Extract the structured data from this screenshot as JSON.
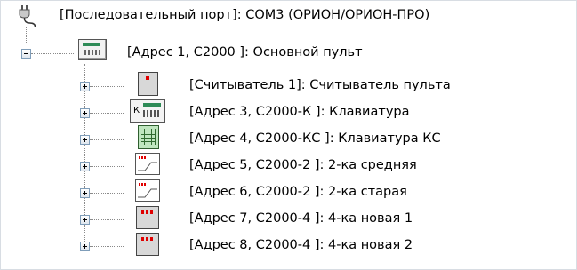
{
  "tree": {
    "root": {
      "label": "[Последовательный порт]: COM3 (ОРИОН/ОРИОН-ПРО)",
      "icon": "serial-port-plug-icon"
    },
    "panel": {
      "label": "[Адрес 1, С2000 ]: Основной пульт",
      "icon": "control-panel-icon",
      "expanded": true
    },
    "children": [
      {
        "label": "[Считыватель 1]: Считыватель пульта",
        "icon": "reader-device-icon",
        "expanded": false
      },
      {
        "label": "[Адрес 3, С2000-К ]: Клавиатура",
        "icon": "keyboard-k-icon",
        "expanded": false
      },
      {
        "label": "[Адрес 4, С2000-КС ]: Клавиатура КС",
        "icon": "keyboard-kc-icon",
        "expanded": false
      },
      {
        "label": "[Адрес 5, С2000-2 ]: 2-ка средняя",
        "icon": "controller-2-icon",
        "expanded": false
      },
      {
        "label": "[Адрес 6, С2000-2 ]: 2-ка старая",
        "icon": "controller-2-icon",
        "expanded": false
      },
      {
        "label": "[Адрес 7, С2000-4 ]: 4-ка новая 1",
        "icon": "controller-4-icon",
        "expanded": false
      },
      {
        "label": "[Адрес 8, С2000-4 ]: 4-ка новая 2",
        "icon": "controller-4-icon",
        "expanded": false
      }
    ],
    "k_icon_letter": "К"
  }
}
